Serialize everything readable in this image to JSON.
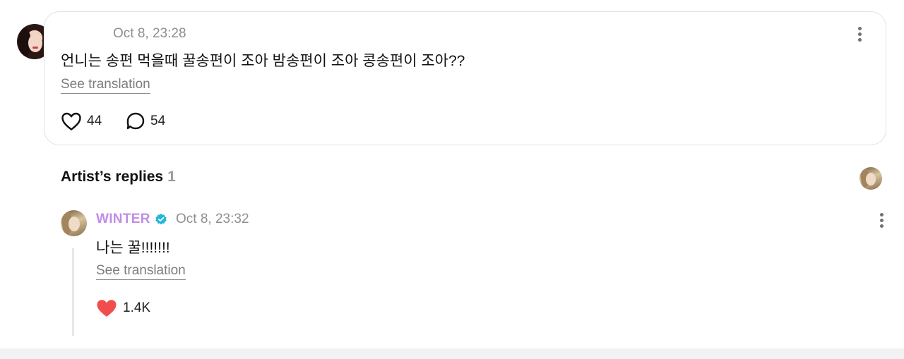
{
  "post": {
    "timestamp": "Oct 8, 23:28",
    "text": "언니는 송편 먹을때 꿀송편이 조아 밤송편이 조아 콩송편이 조아??",
    "see_translation": "See translation",
    "likes": "44",
    "comments": "54"
  },
  "replies_section": {
    "title": "Artist’s replies",
    "count": "1"
  },
  "reply": {
    "author": "WINTER",
    "timestamp": "Oct 8, 23:32",
    "text": "나는 꿀!!!!!!!",
    "see_translation": "See translation",
    "likes": "1.4K"
  },
  "colors": {
    "artist_name": "#c08ee8",
    "verified": "#1fb6d8",
    "liked_heart": "#f04e4e",
    "muted_text": "#8e8e93"
  },
  "icons": {
    "post_like": "heart-outline-icon",
    "post_comment": "speech-bubble-icon",
    "reply_like": "heart-filled-icon",
    "verified": "verified-badge-icon",
    "more": "more-vertical-icon"
  }
}
